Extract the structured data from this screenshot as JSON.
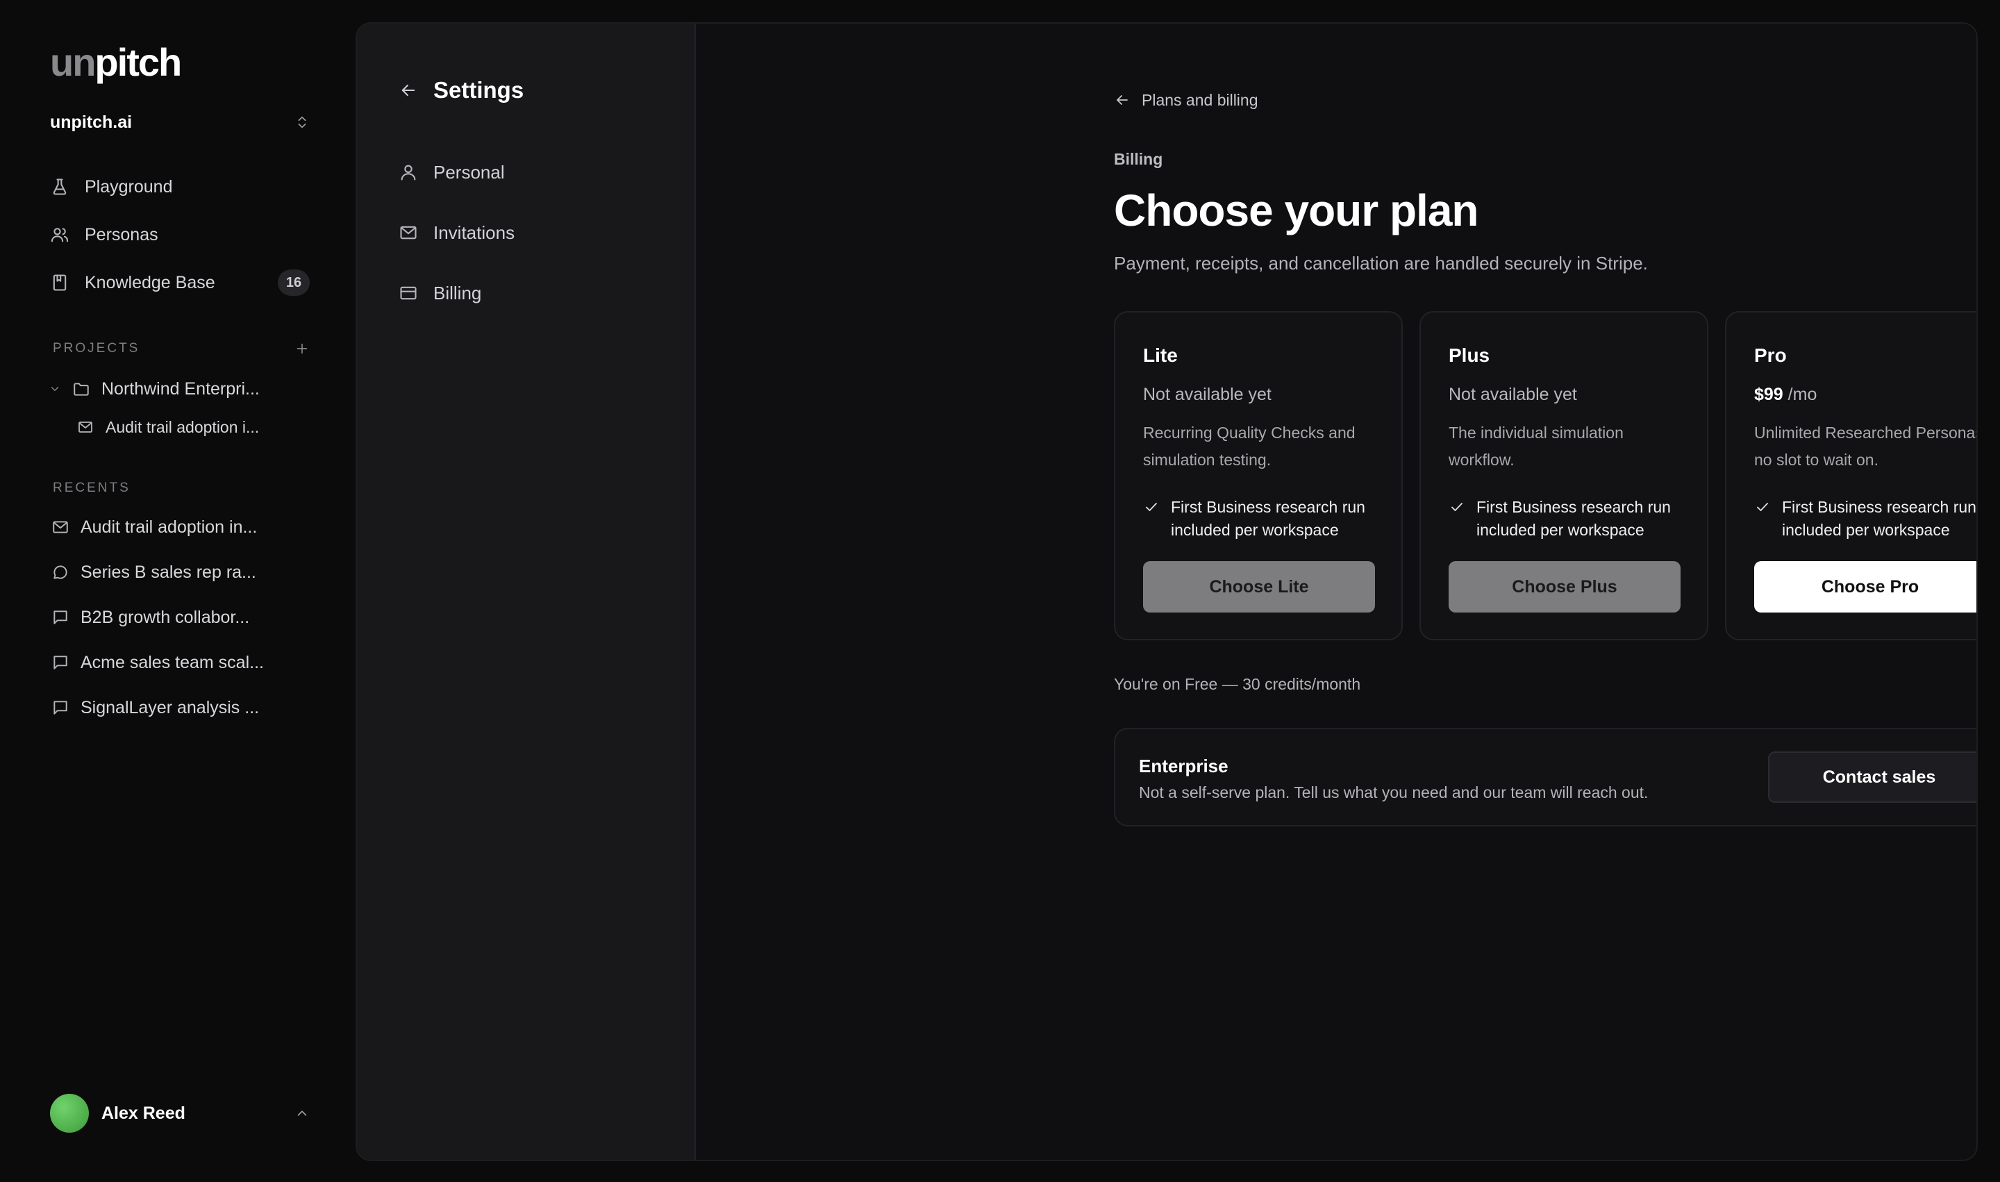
{
  "brand": {
    "logo_dim": "un",
    "logo_bright": "pitch"
  },
  "workspace": {
    "name": "unpitch.ai"
  },
  "nav": [
    {
      "label": "Playground",
      "icon": "flask-icon"
    },
    {
      "label": "Personas",
      "icon": "users-icon"
    },
    {
      "label": "Knowledge Base",
      "icon": "book-icon",
      "badge": "16"
    }
  ],
  "projects": {
    "heading": "PROJECTS",
    "items": [
      {
        "label": "Northwind Enterpri..."
      },
      {
        "label": "Audit trail adoption i..."
      }
    ]
  },
  "recents": {
    "heading": "RECENTS",
    "items": [
      {
        "label": "Audit trail adoption in...",
        "icon": "mail-icon"
      },
      {
        "label": "Series B sales rep ra...",
        "icon": "chat-round-icon"
      },
      {
        "label": "B2B growth collabor...",
        "icon": "chat-square-icon"
      },
      {
        "label": "Acme sales team scal...",
        "icon": "chat-square-icon"
      },
      {
        "label": "SignalLayer analysis ...",
        "icon": "chat-square-icon"
      }
    ]
  },
  "user": {
    "name": "Alex Reed"
  },
  "settings": {
    "title": "Settings",
    "items": [
      {
        "label": "Personal",
        "icon": "person-icon"
      },
      {
        "label": "Invitations",
        "icon": "envelope-icon"
      },
      {
        "label": "Billing",
        "icon": "card-icon"
      }
    ]
  },
  "billing": {
    "breadcrumb": "Plans and billing",
    "eyebrow": "Billing",
    "title": "Choose your plan",
    "subtitle": "Payment, receipts, and cancellation are handled securely in Stripe.",
    "plans": [
      {
        "name": "Lite",
        "price_status": "Not available yet",
        "description": "Recurring Quality Checks and simulation testing.",
        "feature": "First Business research run included per workspace",
        "button": "Choose Lite"
      },
      {
        "name": "Plus",
        "price_status": "Not available yet",
        "description": "The individual simulation workflow.",
        "feature": "First Business research run included per workspace",
        "button": "Choose Plus"
      },
      {
        "name": "Pro",
        "price": "$99",
        "price_unit": "/mo",
        "description": "Unlimited Researched Personas, no slot to wait on.",
        "feature": "First Business research run included per workspace",
        "button": "Choose Pro"
      }
    ],
    "current_plan": "You're on Free — 30 credits/month",
    "enterprise": {
      "name": "Enterprise",
      "description": "Not a self-serve plan. Tell us what you need and our team will reach out.",
      "button": "Contact sales"
    }
  },
  "colors": {
    "background": "#0b0b0c",
    "panel": "#0f0f11",
    "settings_panel": "#18181b",
    "primary_button": "#ffffff",
    "disabled_button": "#7d7d80"
  }
}
